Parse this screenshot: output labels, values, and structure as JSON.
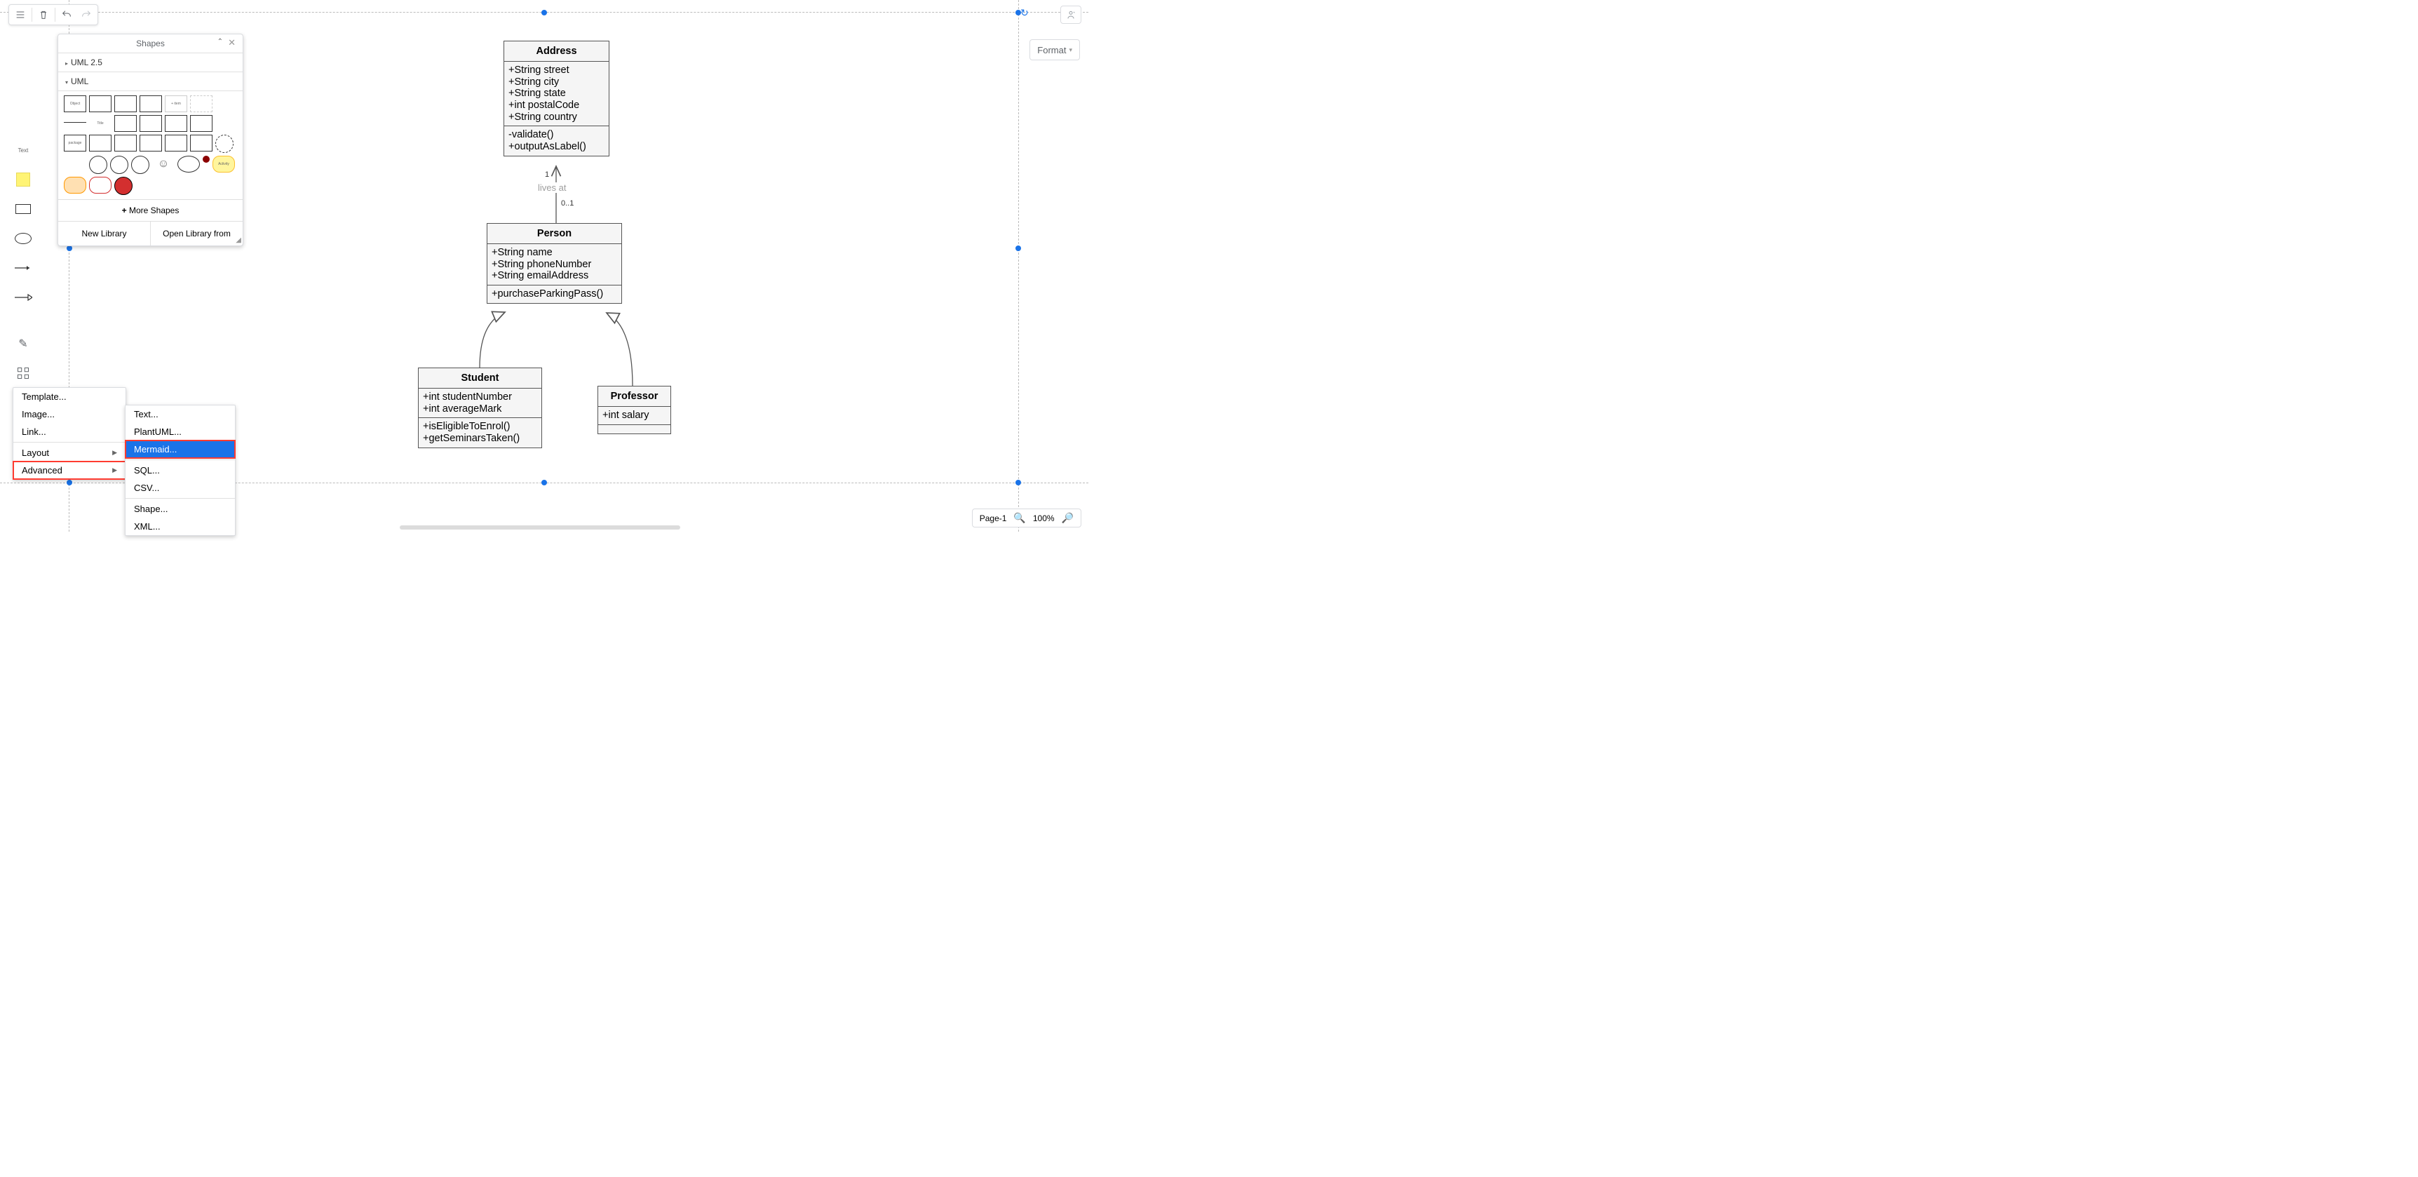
{
  "toolbar": {
    "menu": "menu",
    "trash": "trash",
    "undo": "undo",
    "redo": "redo"
  },
  "format_button": "Format",
  "shapes_panel": {
    "title": "Shapes",
    "section_uml25": "UML 2.5",
    "section_uml": "UML",
    "more": "More Shapes",
    "new_library": "New Library",
    "open_library": "Open Library from"
  },
  "left_tools": {
    "text_label": "Text"
  },
  "insert_menu": {
    "template": "Template...",
    "image": "Image...",
    "link": "Link...",
    "layout": "Layout",
    "advanced": "Advanced"
  },
  "advanced_menu": {
    "text": "Text...",
    "plantuml": "PlantUML...",
    "mermaid": "Mermaid...",
    "sql": "SQL...",
    "csv": "CSV...",
    "shape": "Shape...",
    "xml": "XML..."
  },
  "uml": {
    "address": {
      "title": "Address",
      "attrs": [
        "+String street",
        "+String city",
        "+String state",
        "+int postalCode",
        "+String country"
      ],
      "ops": [
        "-validate()",
        "+outputAsLabel()"
      ]
    },
    "person": {
      "title": "Person",
      "attrs": [
        "+String name",
        "+String phoneNumber",
        "+String emailAddress"
      ],
      "ops": [
        "+purchaseParkingPass()"
      ]
    },
    "student": {
      "title": "Student",
      "attrs": [
        "+int studentNumber",
        "+int averageMark"
      ],
      "ops": [
        "+isEligibleToEnrol()",
        "+getSeminarsTaken()"
      ]
    },
    "professor": {
      "title": "Professor",
      "attrs": [
        "+int salary"
      ]
    },
    "edge_lives_at": "lives at",
    "mult_1": "1",
    "mult_01": "0..1"
  },
  "bottom": {
    "page": "Page-1",
    "zoom": "100%"
  }
}
